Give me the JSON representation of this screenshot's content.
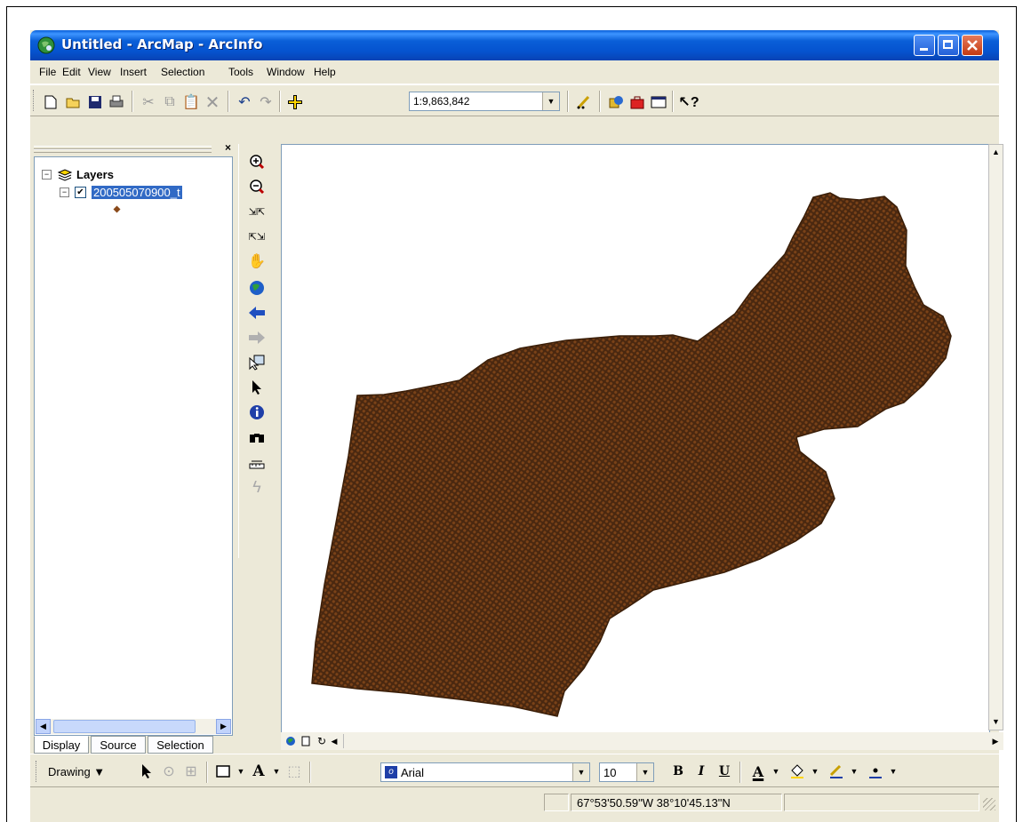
{
  "window": {
    "title": "Untitled - ArcMap - ArcInfo"
  },
  "menu": {
    "items": [
      "File",
      "Edit",
      "View",
      "Insert",
      "Selection",
      "Tools",
      "Window",
      "Help"
    ]
  },
  "toolbar": {
    "scale": "1:9,863,842"
  },
  "toc": {
    "root_label": "Layers",
    "layer_label": "200505070900_t",
    "layer_checked": true,
    "tabs": [
      "Display",
      "Source",
      "Selection"
    ]
  },
  "drawing": {
    "menu_label": "Drawing",
    "font_name": "Arial",
    "font_size": "10",
    "bold_label": "B",
    "italic_label": "I",
    "underline_label": "U"
  },
  "status": {
    "coordinates": "67°53'50.59\"W  38°10'45.13\"N"
  },
  "colors": {
    "map_polygon": "#5a3214",
    "titlebar": "#0a5fd8",
    "selection": "#316ac5"
  }
}
